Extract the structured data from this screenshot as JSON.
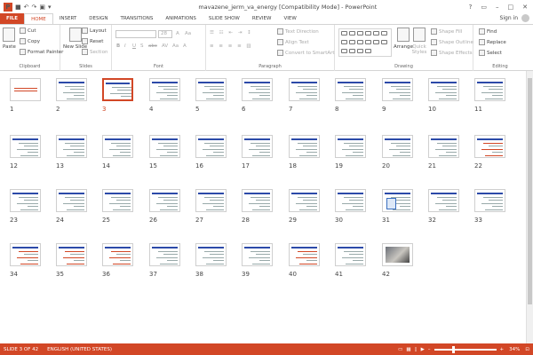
{
  "titlebar": {
    "title": "mavazene_jerm_va_energy [Compatibility Mode] - PowerPoint",
    "app_icon": "P",
    "qat": [
      "save-icon",
      "undo-icon",
      "redo-icon",
      "start-from-beginning-icon",
      "customize-qat-icon"
    ],
    "window_buttons": [
      "?",
      "▭",
      "–",
      "□",
      "✕"
    ]
  },
  "tabs": [
    {
      "label": "FILE",
      "kind": "file"
    },
    {
      "label": "HOME",
      "kind": "active"
    },
    {
      "label": "INSERT"
    },
    {
      "label": "DESIGN"
    },
    {
      "label": "TRANSITIONS"
    },
    {
      "label": "ANIMATIONS"
    },
    {
      "label": "SLIDE SHOW"
    },
    {
      "label": "REVIEW"
    },
    {
      "label": "VIEW"
    }
  ],
  "signin": "Sign in",
  "ribbon": {
    "clipboard": {
      "paste": "Paste",
      "cut": "Cut",
      "copy": "Copy",
      "format_painter": "Format Painter",
      "label": "Clipboard"
    },
    "slides": {
      "new_slide": "New Slide",
      "layout": "Layout",
      "reset": "Reset",
      "section": "Section",
      "label": "Slides"
    },
    "font": {
      "font_size": "28",
      "label": "Font",
      "b": "B",
      "i": "I",
      "u": "U",
      "s": "S",
      "abc": "abc",
      "av": "AV",
      "aa": "Aa",
      "a": "A"
    },
    "paragraph": {
      "text_direction": "Text Direction",
      "align_text": "Align Text",
      "convert_smartart": "Convert to SmartArt",
      "label": "Paragraph"
    },
    "drawing": {
      "arrange": "Arrange",
      "quick_styles": "Quick Styles",
      "shape_fill": "Shape Fill",
      "shape_outline": "Shape Outline",
      "shape_effects": "Shape Effects",
      "label": "Drawing"
    },
    "editing": {
      "find": "Find",
      "replace": "Replace",
      "select": "Select",
      "label": "Editing"
    }
  },
  "slides": [
    {
      "n": "1",
      "style": "title"
    },
    {
      "n": "2",
      "style": "text"
    },
    {
      "n": "3",
      "style": "text",
      "selected": true
    },
    {
      "n": "4",
      "style": "text"
    },
    {
      "n": "5",
      "style": "text"
    },
    {
      "n": "6",
      "style": "text"
    },
    {
      "n": "7",
      "style": "text"
    },
    {
      "n": "8",
      "style": "text"
    },
    {
      "n": "9",
      "style": "text"
    },
    {
      "n": "10",
      "style": "text"
    },
    {
      "n": "11",
      "style": "text"
    },
    {
      "n": "12",
      "style": "text"
    },
    {
      "n": "13",
      "style": "text"
    },
    {
      "n": "14",
      "style": "text"
    },
    {
      "n": "15",
      "style": "text"
    },
    {
      "n": "16",
      "style": "text"
    },
    {
      "n": "17",
      "style": "text"
    },
    {
      "n": "18",
      "style": "text"
    },
    {
      "n": "19",
      "style": "text"
    },
    {
      "n": "20",
      "style": "text"
    },
    {
      "n": "21",
      "style": "text"
    },
    {
      "n": "22",
      "style": "red"
    },
    {
      "n": "23",
      "style": "text"
    },
    {
      "n": "24",
      "style": "text"
    },
    {
      "n": "25",
      "style": "text"
    },
    {
      "n": "26",
      "style": "text"
    },
    {
      "n": "27",
      "style": "text"
    },
    {
      "n": "28",
      "style": "text"
    },
    {
      "n": "29",
      "style": "text"
    },
    {
      "n": "30",
      "style": "text"
    },
    {
      "n": "31",
      "style": "diagram"
    },
    {
      "n": "32",
      "style": "text"
    },
    {
      "n": "33",
      "style": "text"
    },
    {
      "n": "34",
      "style": "red"
    },
    {
      "n": "35",
      "style": "red"
    },
    {
      "n": "36",
      "style": "red"
    },
    {
      "n": "37",
      "style": "text"
    },
    {
      "n": "38",
      "style": "text"
    },
    {
      "n": "39",
      "style": "text"
    },
    {
      "n": "40",
      "style": "red"
    },
    {
      "n": "41",
      "style": "text"
    },
    {
      "n": "42",
      "style": "photo"
    }
  ],
  "status": {
    "slide_of": "SLIDE 3 OF 42",
    "language": "ENGLISH (UNITED STATES)",
    "zoom": "34%",
    "zoom_minus": "–",
    "zoom_plus": "+"
  },
  "colors": {
    "accent": "#d24726",
    "slide_bar": "#2c4aa8"
  }
}
